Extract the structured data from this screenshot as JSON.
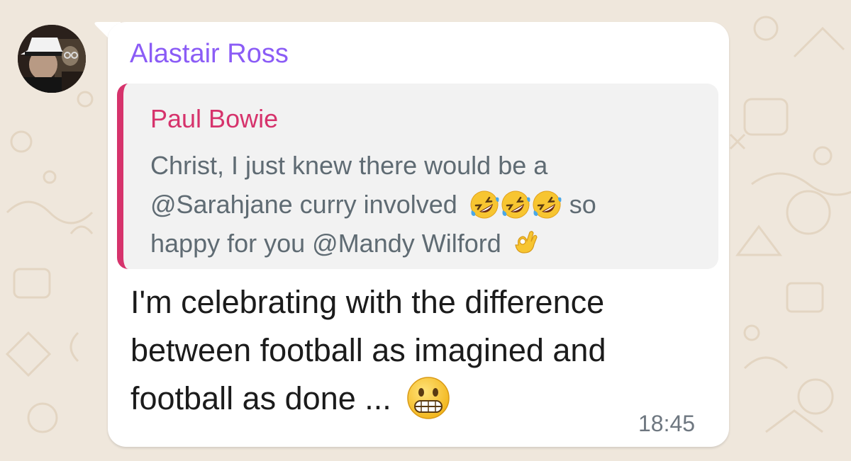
{
  "chat": {
    "message": {
      "sender_name": "Alastair Ross",
      "sender_color": "#8b5cf6",
      "quoted": {
        "author": "Paul Bowie",
        "author_color": "#d6336c",
        "line1": "Christ, I just knew there would be a",
        "line2_pre": "@Sarahjane curry involved",
        "line2_emojis": [
          "rolling-on-floor-laughing",
          "rolling-on-floor-laughing",
          "rolling-on-floor-laughing"
        ],
        "line2_post": "so",
        "line3": "happy for you @Mandy Wilford",
        "line3_emoji": "ok-hand"
      },
      "text_line1": "I'm celebrating with the difference",
      "text_line2": "between football as imagined and",
      "text_line3": "football as done ...",
      "text_emoji": "grimacing-face",
      "time": "18:45"
    }
  }
}
